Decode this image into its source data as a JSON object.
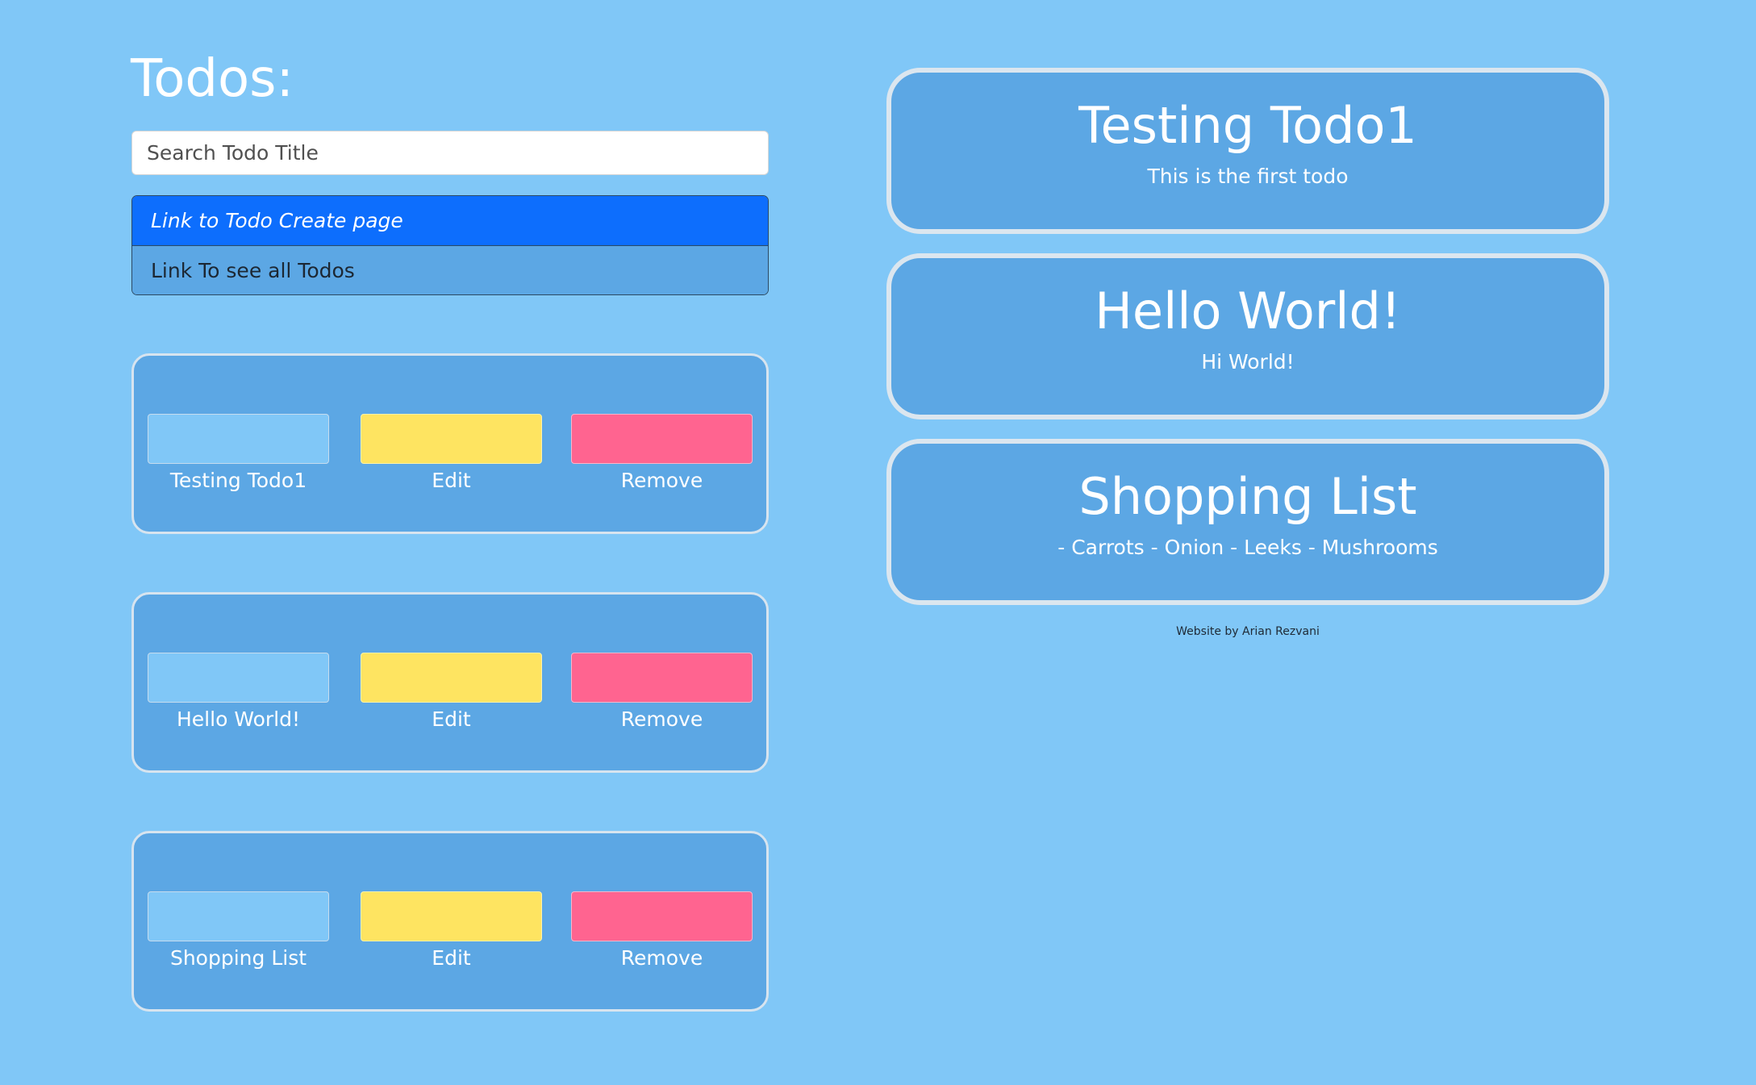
{
  "colors": {
    "background": "#80c7f7",
    "card": "#5ca7e4",
    "active_link": "#0d6efd",
    "edit": "#fee461",
    "remove": "#ff6490"
  },
  "header": {
    "title": "Todos:"
  },
  "search": {
    "placeholder": "Search Todo Title",
    "value": ""
  },
  "links": [
    {
      "label": "Link to Todo Create page",
      "active": true
    },
    {
      "label": "Link To see all Todos",
      "active": false
    }
  ],
  "todo_rows": [
    {
      "title": "Testing Todo1",
      "edit_label": "Edit",
      "remove_label": "Remove"
    },
    {
      "title": "Hello World!",
      "edit_label": "Edit",
      "remove_label": "Remove"
    },
    {
      "title": "Shopping List",
      "edit_label": "Edit",
      "remove_label": "Remove"
    }
  ],
  "todo_cards": [
    {
      "title": "Testing Todo1",
      "description": "This is the first todo"
    },
    {
      "title": "Hello World!",
      "description": "Hi World!"
    },
    {
      "title": "Shopping List",
      "description": "- Carrots - Onion - Leeks - Mushrooms"
    }
  ],
  "footer": {
    "credit": "Website by Arian Rezvani"
  }
}
